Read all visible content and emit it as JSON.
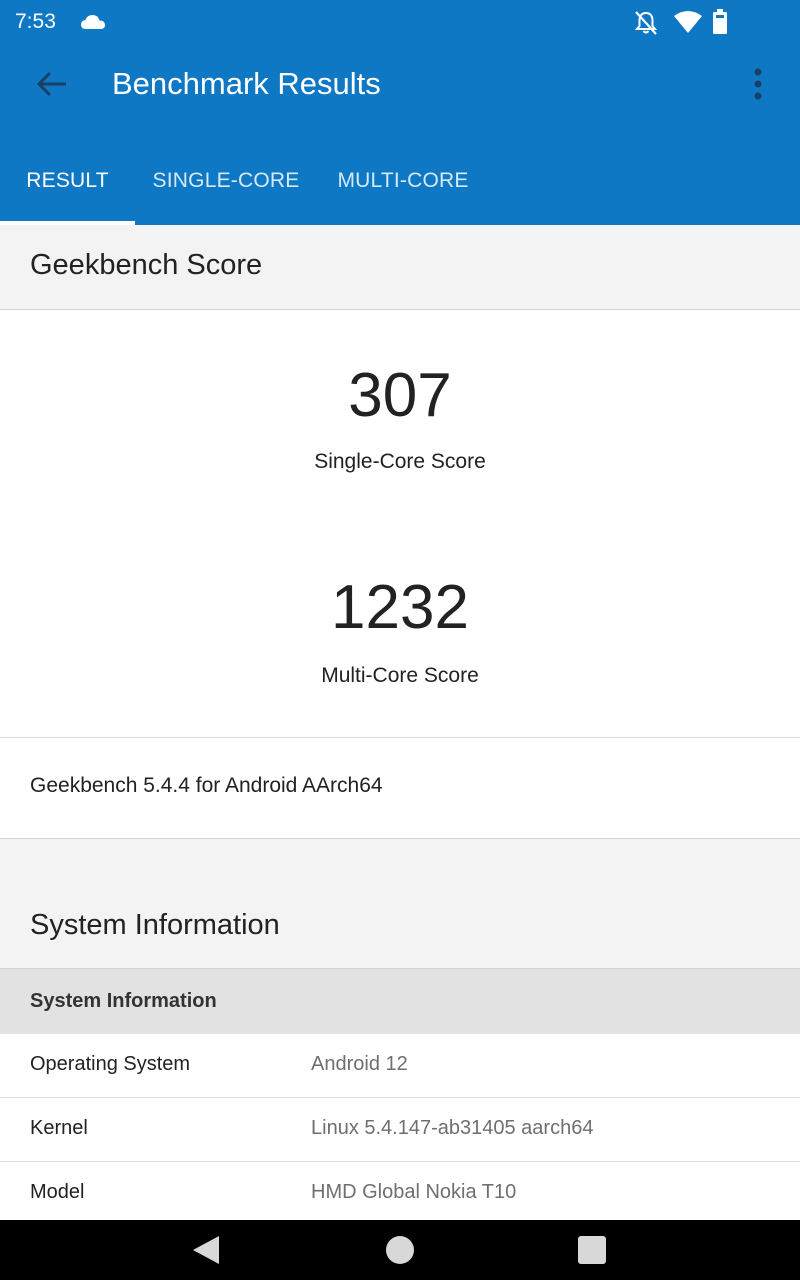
{
  "status_bar": {
    "time": "7:53",
    "icons": [
      "cloud-icon",
      "bell-off-icon",
      "wifi-icon",
      "battery-icon"
    ]
  },
  "toolbar": {
    "title": "Benchmark Results",
    "back_icon": "back-arrow-icon",
    "more_icon": "more-vert-icon"
  },
  "tabs": [
    {
      "label": "RESULT",
      "active": true
    },
    {
      "label": "SINGLE-CORE",
      "active": false
    },
    {
      "label": "MULTI-CORE",
      "active": false
    }
  ],
  "geekbench": {
    "header": "Geekbench Score",
    "single_core_score": "307",
    "single_core_label": "Single-Core Score",
    "multi_core_score": "1232",
    "multi_core_label": "Multi-Core Score",
    "version": "Geekbench 5.4.4 for Android AArch64"
  },
  "system_info": {
    "header": "System Information",
    "table_header": "System Information",
    "rows": [
      {
        "key": "Operating System",
        "value": "Android 12"
      },
      {
        "key": "Kernel",
        "value": "Linux 5.4.147-ab31405 aarch64"
      },
      {
        "key": "Model",
        "value": "HMD Global Nokia T10"
      }
    ]
  },
  "nav_bar": {
    "icons": [
      "nav-back-icon",
      "nav-home-icon",
      "nav-recents-icon"
    ]
  },
  "colors": {
    "app_bar": "#0f78c5",
    "background": "#f3f3f3",
    "table_header": "#e2e2e2"
  }
}
